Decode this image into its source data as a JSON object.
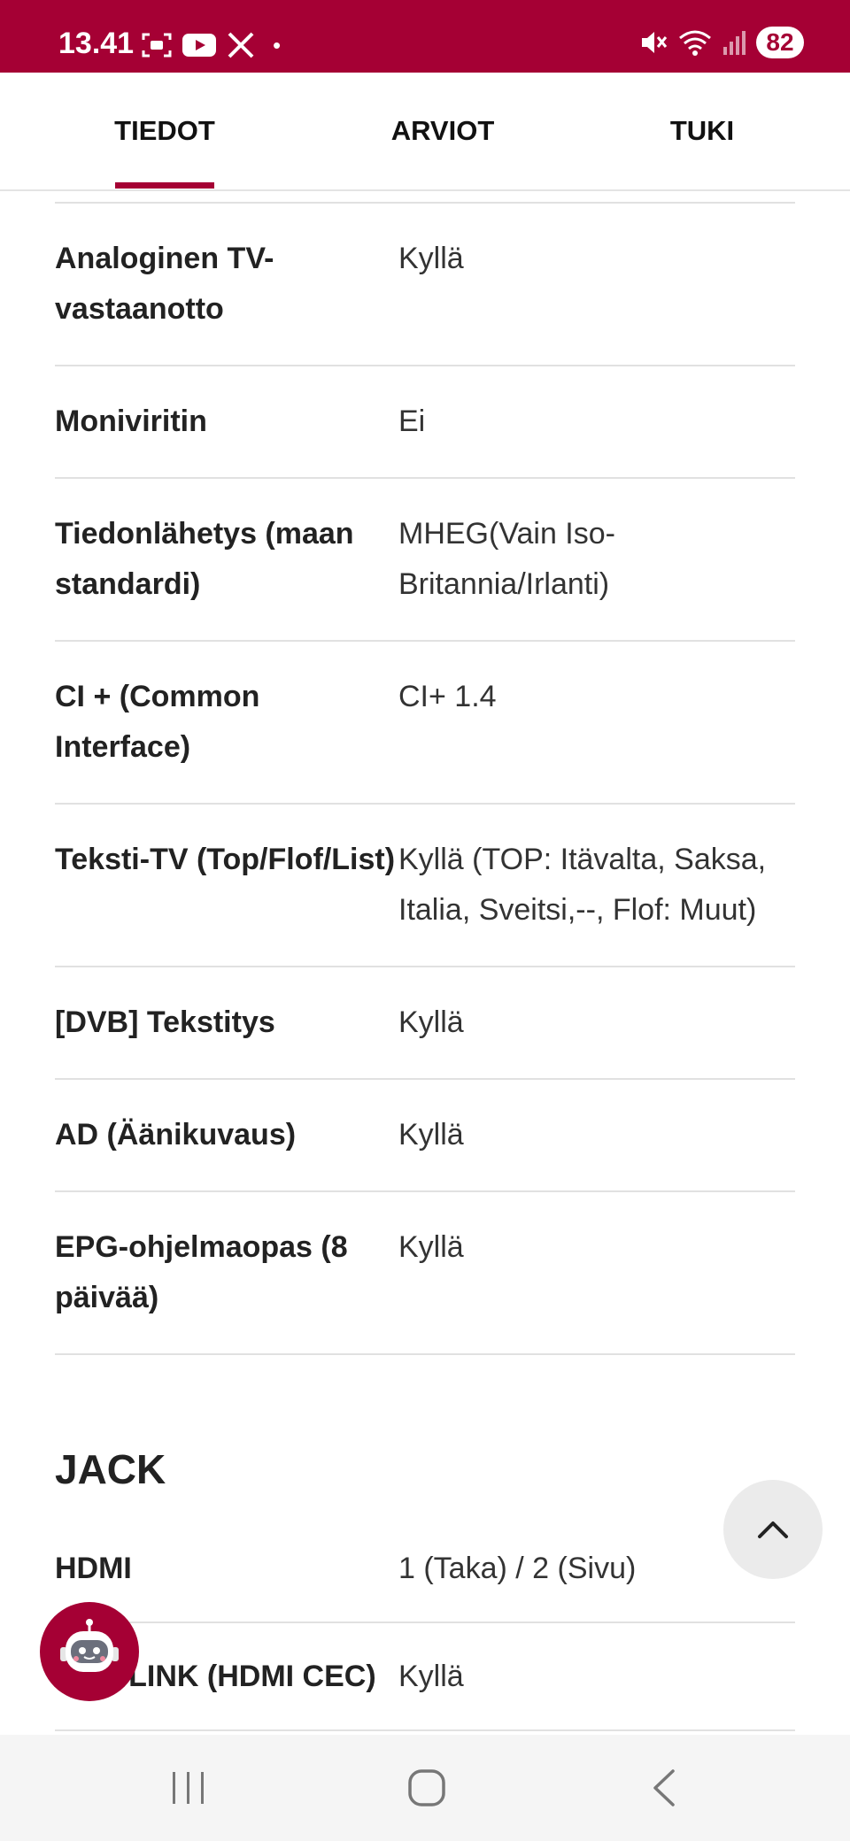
{
  "status_bar": {
    "time": "13.41",
    "battery": "82",
    "notification_dot": "•",
    "icons_left": [
      "screenshot-icon",
      "youtube-icon",
      "x-icon"
    ],
    "icons_right": [
      "mute-icon",
      "wifi-icon",
      "signal-icon"
    ]
  },
  "tabs": [
    {
      "label": "TIEDOT",
      "active": true
    },
    {
      "label": "ARVIOT",
      "active": false
    },
    {
      "label": "TUKI",
      "active": false
    }
  ],
  "specs": [
    {
      "label": "Analoginen TV-vastaanotto",
      "value": "Kyllä"
    },
    {
      "label": "Moniviritin",
      "value": "Ei"
    },
    {
      "label": "Tiedonlähetys (maan standardi)",
      "value": "MHEG(Vain Iso-Britannia/Irlanti)"
    },
    {
      "label": "CI + (Common Interface)",
      "value": "CI+ 1.4"
    },
    {
      "label": "Teksti-TV (Top/Flof/List)",
      "value": "Kyllä (TOP: Itävalta, Saksa, Italia, Sveitsi,--, Flof: Muut)"
    },
    {
      "label": "[DVB] Tekstitys",
      "value": "Kyllä"
    },
    {
      "label": "AD (Äänikuvaus)",
      "value": "Kyllä"
    },
    {
      "label": "EPG-ohjelmaopas (8 päivää)",
      "value": "Kyllä"
    }
  ],
  "jack_section": {
    "title": "JACK",
    "rows": [
      {
        "label": "HDMI",
        "value": "1 (Taka) / 2 (Sivu)"
      },
      {
        "label": "SIMPLINK (HDMI CEC)",
        "value": "Kyllä"
      }
    ]
  },
  "colors": {
    "brand": "#a50034",
    "divider": "#e1e1e1",
    "navbar_bg": "#f5f5f5"
  }
}
